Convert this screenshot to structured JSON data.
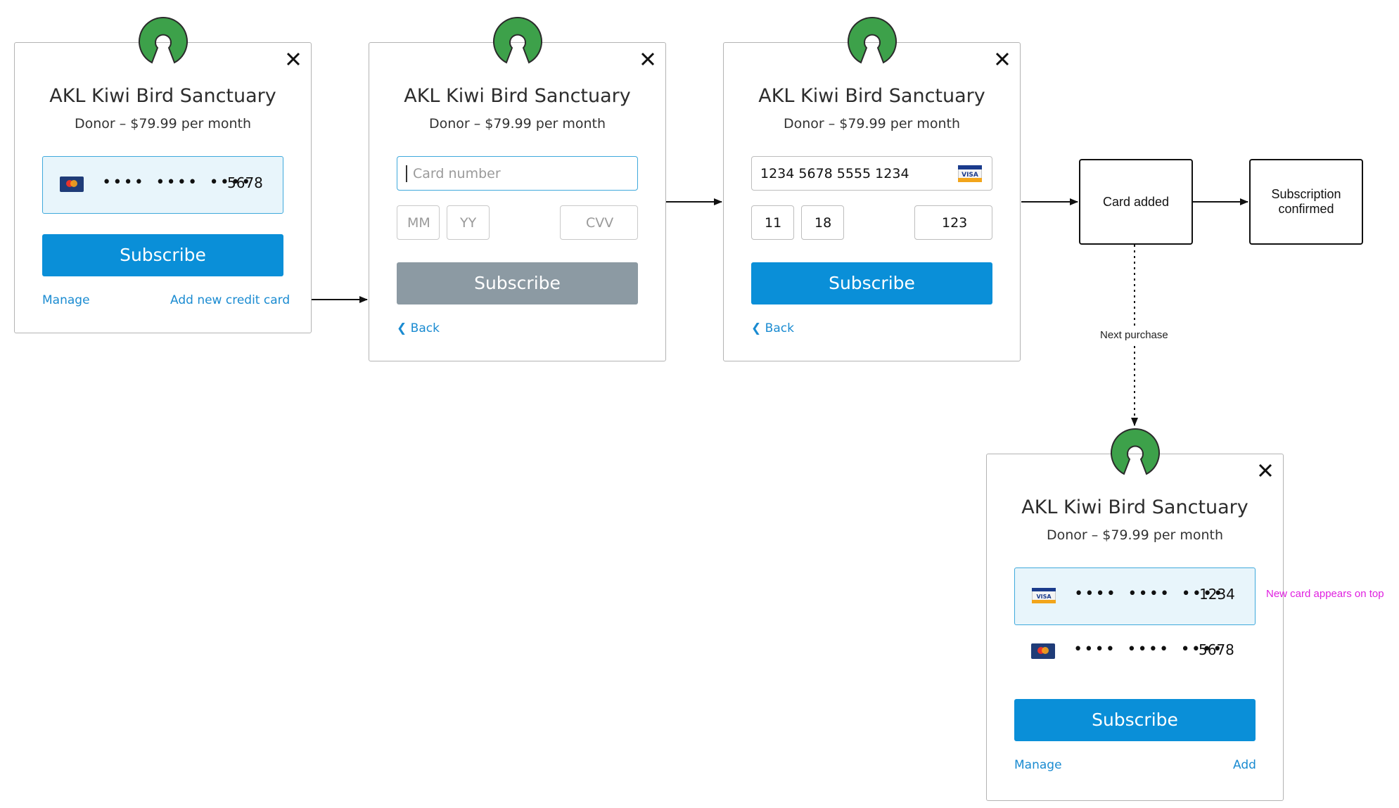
{
  "brand": {
    "org": "AKL Kiwi Bird Sanctuary",
    "plan": "Donor – $79.99 per month",
    "accent": "#0a8fd8",
    "logo_color": "#3da14a"
  },
  "panel1": {
    "card": {
      "icon": "mastercard-icon",
      "dots": "•••• •••• ••••",
      "last4": "5678"
    },
    "subscribe": "Subscribe",
    "manage": "Manage",
    "add_card": "Add new credit card"
  },
  "panel2": {
    "card_number_placeholder": "Card number",
    "mm_placeholder": "MM",
    "yy_placeholder": "YY",
    "cvv_placeholder": "CVV",
    "subscribe": "Subscribe",
    "back": "Back"
  },
  "panel3": {
    "card_number": "1234  5678  5555  1234",
    "card_icon": "visa-icon",
    "mm": "11",
    "yy": "18",
    "cvv": "123",
    "subscribe": "Subscribe",
    "back": "Back"
  },
  "flow": {
    "card_added": "Card added",
    "subscription_confirmed": "Subscription confirmed",
    "next_purchase": "Next purchase"
  },
  "panel4": {
    "cards": [
      {
        "icon": "visa-icon",
        "dots": "•••• •••• ••••",
        "last4": "1234",
        "selected": true
      },
      {
        "icon": "mastercard-icon",
        "dots": "•••• •••• ••••",
        "last4": "5678",
        "selected": false
      }
    ],
    "subscribe": "Subscribe",
    "manage": "Manage",
    "add": "Add",
    "annotation": "New card appears on top"
  }
}
